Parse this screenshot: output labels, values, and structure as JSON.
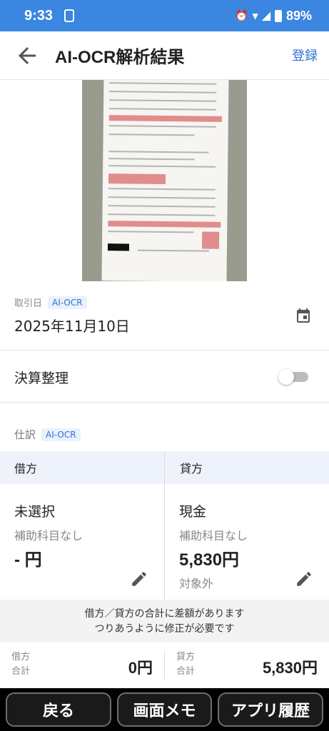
{
  "status_bar": {
    "time": "9:33",
    "battery": "89%"
  },
  "app_bar": {
    "title": "AI-OCR解析結果",
    "register_label": "登録"
  },
  "transaction_date": {
    "label": "取引日",
    "badge": "AI-OCR",
    "value": "2025年11月10日"
  },
  "settlement": {
    "label": "決算整理",
    "enabled": false
  },
  "journal": {
    "label": "仕訳",
    "badge": "AI-OCR",
    "debit_header": "借方",
    "credit_header": "貸方",
    "debit": {
      "account": "未選択",
      "sub_account": "補助科目なし",
      "amount": "- 円"
    },
    "credit": {
      "account": "現金",
      "sub_account": "補助科目なし",
      "amount": "5,830円",
      "tax": "対象外"
    }
  },
  "warning": {
    "line1": "借方／貸方の合計に差額があります",
    "line2": "つりあうように修正が必要です"
  },
  "totals": {
    "debit_label": "借方 合計",
    "debit_value": "0円",
    "credit_label": "貸方 合計",
    "credit_value": "5,830円"
  },
  "bottom_nav": {
    "back": "戻る",
    "memo": "画面メモ",
    "history": "アプリ履歴"
  },
  "colors": {
    "accent": "#3a86e0",
    "link": "#2f6fd6",
    "header_bg": "#eef2fb"
  },
  "icons": [
    "back-arrow-icon",
    "calendar-icon",
    "pencil-icon",
    "wifi-icon",
    "signal-icon",
    "alarm-icon"
  ]
}
